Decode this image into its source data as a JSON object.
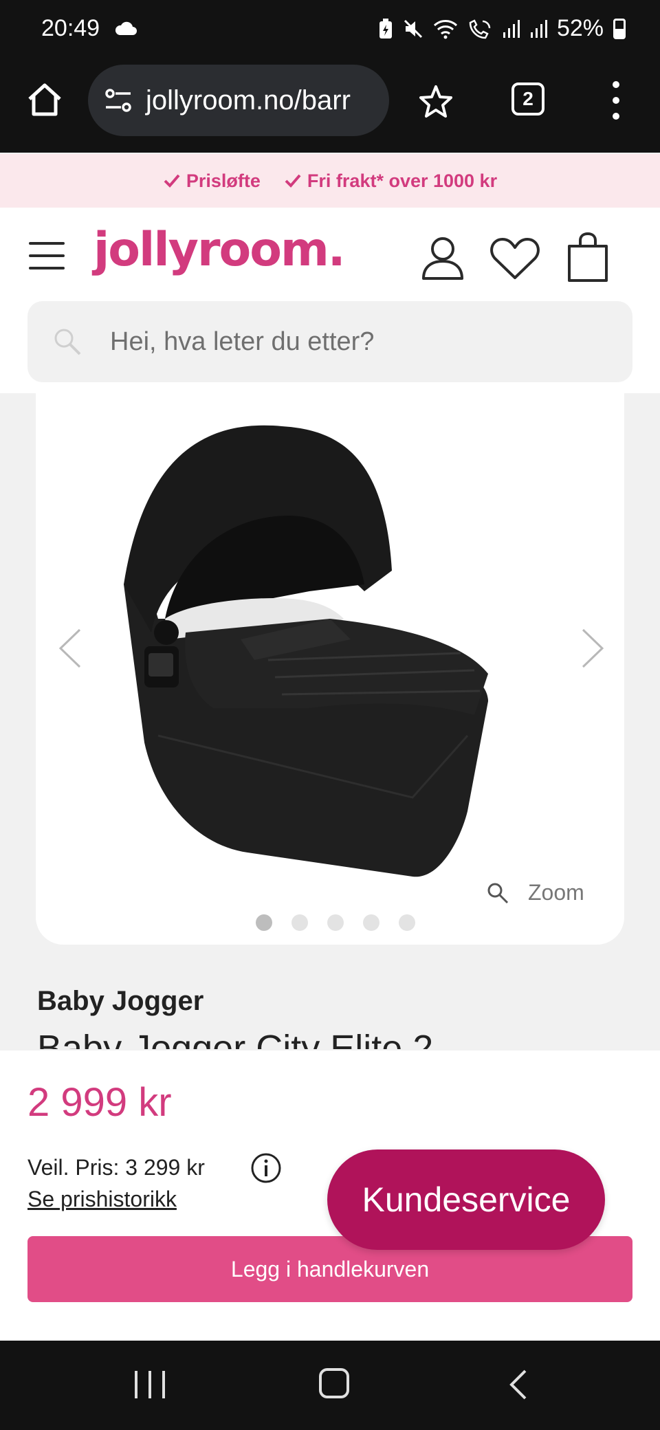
{
  "status_bar": {
    "time": "20:49",
    "battery": "52%",
    "icons": [
      "cloud-icon",
      "battery-saver-icon",
      "mute-icon",
      "wifi-icon",
      "wifi-calling-icon",
      "signal-icon",
      "signal-icon",
      "battery-icon"
    ]
  },
  "browser": {
    "url": "jollyroom.no/barr",
    "tab_count": "2",
    "icons": [
      "home-icon",
      "site-settings-icon",
      "star-icon",
      "tabs-icon",
      "menu-icon"
    ]
  },
  "promo": {
    "items": [
      "Prisløfte",
      "Fri frakt* over 1000 kr"
    ],
    "color": "#d23b7e"
  },
  "header": {
    "logo": "jollyroom.",
    "search_placeholder": "Hei, hva leter du etter?",
    "icons": [
      "menu-icon",
      "user-icon",
      "heart-icon",
      "bag-icon",
      "search-icon"
    ]
  },
  "gallery": {
    "zoom_label": "Zoom",
    "image_count": 5,
    "active_index": 0
  },
  "product": {
    "brand": "Baby Jogger",
    "title": "Baby Jogger City Elite 2"
  },
  "purchase": {
    "price": "2 999 kr",
    "rrp": "Veil. Pris: 3 299 kr",
    "price_history_link": "Se prishistorikk",
    "customer_service": "Kundeservice",
    "add_to_cart": "Legg i handlekurven",
    "accent": "#e14d87",
    "service_color": "#b0135a"
  }
}
